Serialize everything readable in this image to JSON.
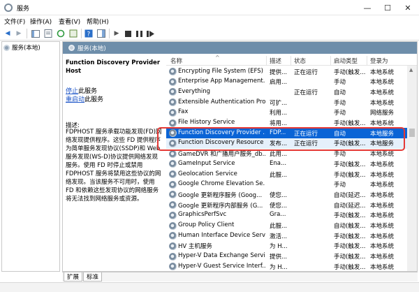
{
  "window": {
    "title": "服务",
    "minimize": "—",
    "maximize": "☐",
    "close": "✕"
  },
  "menu": [
    "文件(F)",
    "操作(A)",
    "查看(V)",
    "帮助(H)"
  ],
  "tree": {
    "label": "服务(本地)"
  },
  "pane": {
    "header": "服务(本地)"
  },
  "desc": {
    "title": "Function Discovery Provider Host",
    "stop_link": "停止",
    "stop_suffix": "此服务",
    "restart_link": "重启动",
    "restart_suffix": "此服务",
    "label": "描述:",
    "body": "FDPHOST 服务承载功能发现(FD)网络发现提供程序。这些 FD 提供程序为简单服务发现协议(SSDP)和 Web 服务发现(WS-D)协议提供网络发现服务。使用 FD 时停止或禁用 FDPHOST 服务将禁用这些协议的网络发现。当该服务不可用时，使用 FD 和依赖这些发现协议的网络服务将无法找到网络服务或资源。"
  },
  "columns": {
    "name": "名称",
    "desc": "描述",
    "status": "状态",
    "startup": "启动类型",
    "logon": "登录为"
  },
  "rows": [
    {
      "name": "Encrypting File System (EFS)",
      "desc": "提供...",
      "status": "正在运行",
      "startup": "手动(触发...",
      "logon": "本地系统"
    },
    {
      "name": "Enterprise App Management...",
      "desc": "启用...",
      "status": "",
      "startup": "手动",
      "logon": "本地系统"
    },
    {
      "name": "Everything",
      "desc": "",
      "status": "正在运行",
      "startup": "自动",
      "logon": "本地系统"
    },
    {
      "name": "Extensible Authentication Proto...",
      "desc": "可扩...",
      "status": "",
      "startup": "手动",
      "logon": "本地系统"
    },
    {
      "name": "Fax",
      "desc": "利用...",
      "status": "",
      "startup": "手动",
      "logon": "网络服务"
    },
    {
      "name": "File History Service",
      "desc": "将用...",
      "status": "",
      "startup": "手动(触发...",
      "logon": "本地系统"
    },
    {
      "name": "Function Discovery Provider ...",
      "desc": "FDP...",
      "status": "正在运行",
      "startup": "自动",
      "logon": "本地服务"
    },
    {
      "name": "Function Discovery Resource ...",
      "desc": "发布...",
      "status": "正在运行",
      "startup": "手动(触发...",
      "logon": "本地服务"
    },
    {
      "name": "GameDVR 和广播用户服务_db...",
      "desc": "此用...",
      "status": "",
      "startup": "手动",
      "logon": "本地系统"
    },
    {
      "name": "GameInput Service",
      "desc": "Ena...",
      "status": "",
      "startup": "手动(触发...",
      "logon": "本地系统"
    },
    {
      "name": "Geolocation Service",
      "desc": "此服...",
      "status": "",
      "startup": "手动(触发...",
      "logon": "本地系统"
    },
    {
      "name": "Google Chrome Elevation Se...",
      "desc": "",
      "status": "",
      "startup": "手动",
      "logon": "本地系统"
    },
    {
      "name": "Google 更新程序服务 (Goog...",
      "desc": "使您...",
      "status": "",
      "startup": "自动(延迟...",
      "logon": "本地系统"
    },
    {
      "name": "Google 更新程序内部服务 (G...",
      "desc": "使您...",
      "status": "",
      "startup": "自动(延迟...",
      "logon": "本地系统"
    },
    {
      "name": "GraphicsPerfSvc",
      "desc": "Gra...",
      "status": "",
      "startup": "手动(触发...",
      "logon": "本地系统"
    },
    {
      "name": "Group Policy Client",
      "desc": "此服...",
      "status": "",
      "startup": "自动(触发...",
      "logon": "本地系统"
    },
    {
      "name": "Human Interface Device Servi...",
      "desc": "激活...",
      "status": "",
      "startup": "手动(触发...",
      "logon": "本地系统"
    },
    {
      "name": "HV 主机服务",
      "desc": "为 H...",
      "status": "",
      "startup": "手动(触发...",
      "logon": "本地系统"
    },
    {
      "name": "Hyper-V Data Exchange Servi...",
      "desc": "提供...",
      "status": "",
      "startup": "手动(触发...",
      "logon": "本地系统"
    },
    {
      "name": "Hyper-V Guest Service Interf...",
      "desc": "为 H...",
      "status": "",
      "startup": "手动(触发...",
      "logon": "本地系统"
    }
  ],
  "tabs": [
    "扩展",
    "标准"
  ],
  "colors": {
    "header": "#6e8eaa",
    "selection": "#0a64d6",
    "highlight_box": "#e53935",
    "link": "#1e56c8"
  }
}
